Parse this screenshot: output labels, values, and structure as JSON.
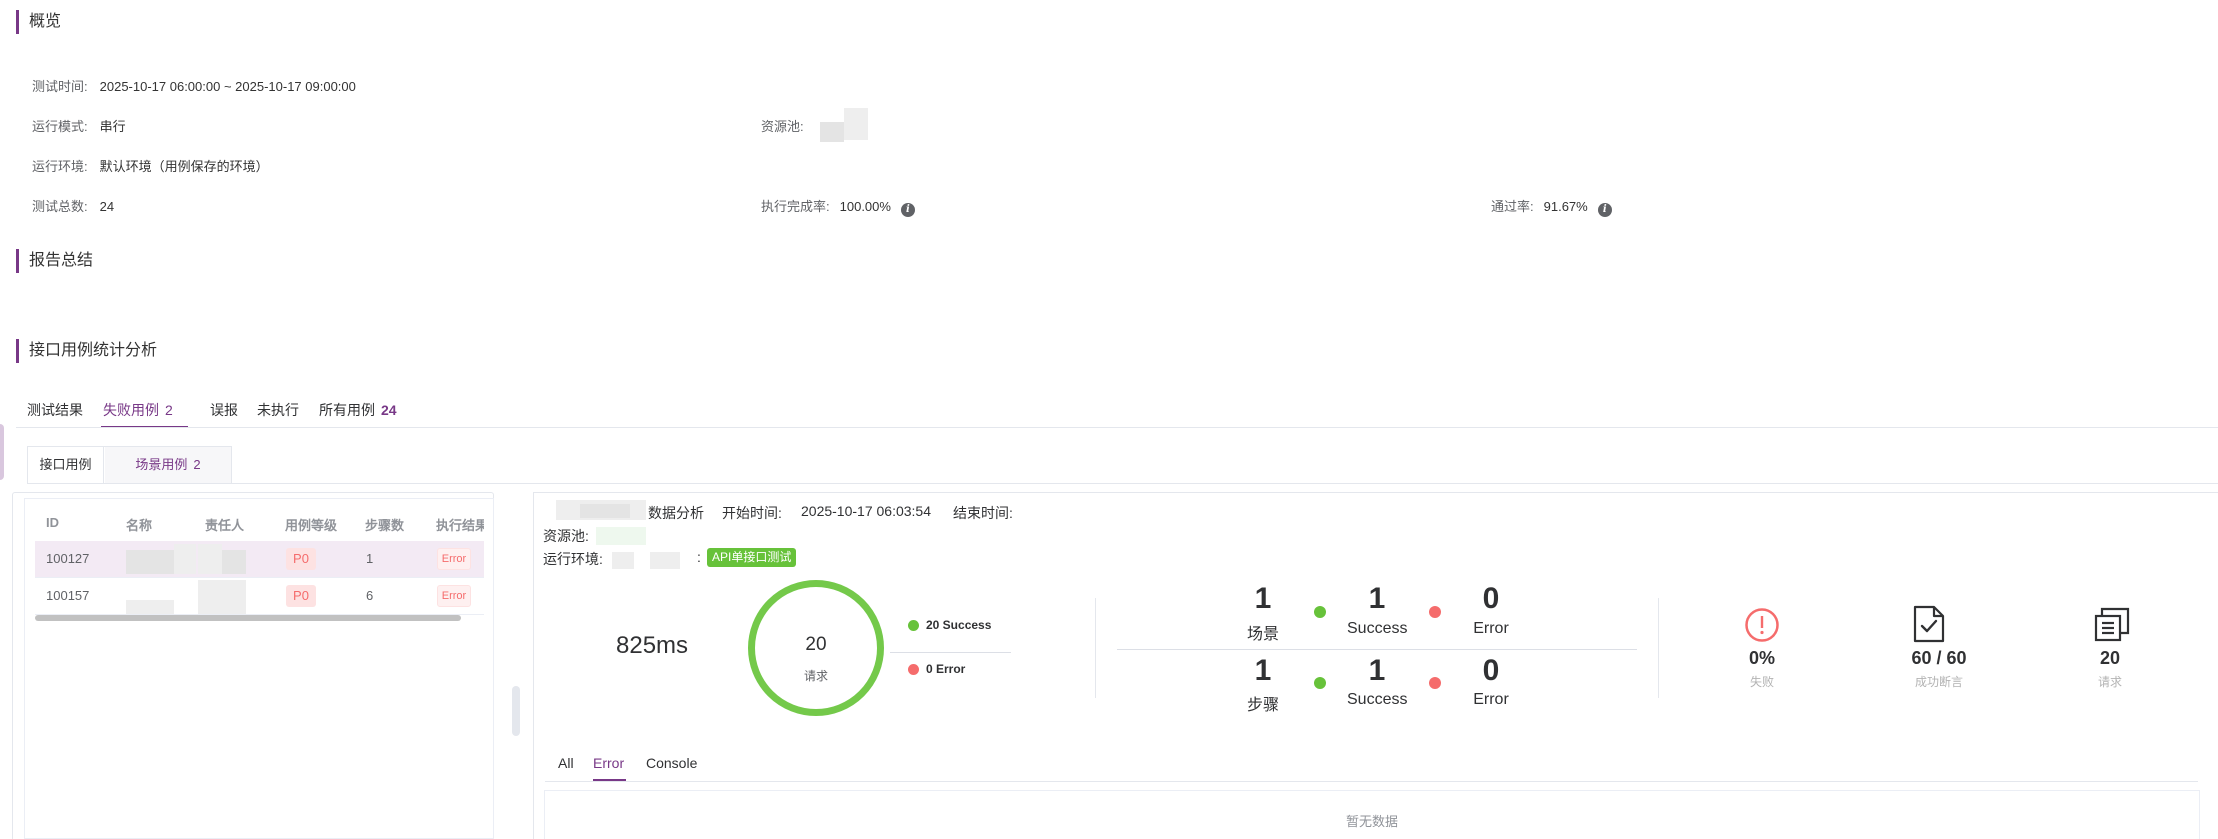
{
  "overview": {
    "title": "概览",
    "test_time_label": "测试时间:",
    "test_time_value": "2025-10-17 06:00:00 ~ 2025-10-17 09:00:00",
    "run_mode_label": "运行模式:",
    "run_mode_value": "串行",
    "resource_pool_label": "资源池:",
    "env_label": "运行环境:",
    "env_value": "默认环境（用例保存的环境）",
    "total_label": "测试总数:",
    "total_value": "24",
    "exec_rate_label": "执行完成率:",
    "exec_rate_value": "100.00%",
    "pass_rate_label": "通过率:",
    "pass_rate_value": "91.67%"
  },
  "summary": {
    "title": "报告总结"
  },
  "analysis": {
    "title": "接口用例统计分析",
    "tabs": [
      {
        "label": "测试结果",
        "count": ""
      },
      {
        "label": "失败用例",
        "count": "2"
      },
      {
        "label": "误报",
        "count": ""
      },
      {
        "label": "未执行",
        "count": ""
      },
      {
        "label": "所有用例",
        "count": "24"
      }
    ],
    "subtabs": [
      {
        "label": "接口用例",
        "count": ""
      },
      {
        "label": "场景用例",
        "count": "2"
      }
    ]
  },
  "case_table": {
    "columns": [
      "ID",
      "名称",
      "责任人",
      "用例等级",
      "步骤数",
      "执行结果"
    ],
    "rows": [
      {
        "id": "100127",
        "level": "P0",
        "steps": "1",
        "result": "Error"
      },
      {
        "id": "100157",
        "level": "P0",
        "steps": "6",
        "result": "Error"
      }
    ]
  },
  "detail": {
    "data_analysis_label": "数据分析",
    "start_time_label": "开始时间:",
    "start_time_value": "2025-10-17 06:03:54",
    "end_time_label": "结束时间:",
    "resource_pool_label": "资源池:",
    "env_label": "运行环境:",
    "env_colon": ":",
    "env_tag": "API单接口测试",
    "duration": "825ms",
    "ring_count": "20",
    "ring_label": "请求",
    "legend_success": "20 Success",
    "legend_error": "0 Error",
    "scenario": {
      "count": "1",
      "label": "场景",
      "success": "1",
      "success_label": "Success",
      "error": "0",
      "error_label": "Error"
    },
    "step": {
      "count": "1",
      "label": "步骤",
      "success": "1",
      "success_label": "Success",
      "error": "0",
      "error_label": "Error"
    },
    "fail": {
      "value": "0%",
      "label": "失败"
    },
    "assertions": {
      "value": "60 / 60",
      "label": "成功断言"
    },
    "requests": {
      "value": "20",
      "label": "请求"
    },
    "log_tabs": [
      "All",
      "Error",
      "Console"
    ],
    "active_log_tab": "Error",
    "empty_text": "暂无数据"
  },
  "colors": {
    "accent": "#783887",
    "success": "#67c23a",
    "error": "#f56c6c"
  }
}
